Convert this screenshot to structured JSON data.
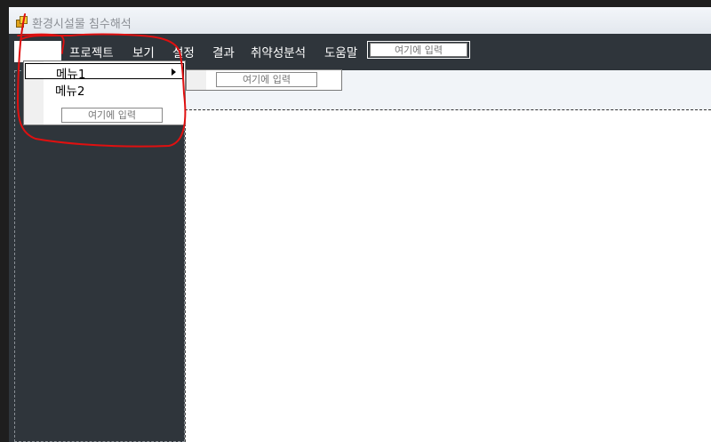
{
  "window": {
    "title": "환경시설물 침수해석"
  },
  "menubar": {
    "items": [
      "",
      "프로젝트",
      "보기",
      "설정",
      "결과",
      "취약성분석",
      "도움말"
    ],
    "input_placeholder": "여기에 입력"
  },
  "dropdown": {
    "items": [
      {
        "label": "메뉴1",
        "has_submenu": true
      },
      {
        "label": "메뉴2",
        "has_submenu": false
      }
    ],
    "input_placeholder": "여기에 입력"
  },
  "submenu": {
    "input_placeholder": "여기에 입력"
  },
  "colors": {
    "window_bg": "#2f353b",
    "menu_text": "#ffffff",
    "content_bg": "#ffffff",
    "annotation": "#e01010"
  },
  "icons": {
    "app": "app-icon",
    "submenu_arrow": "submenu-arrow-icon"
  }
}
